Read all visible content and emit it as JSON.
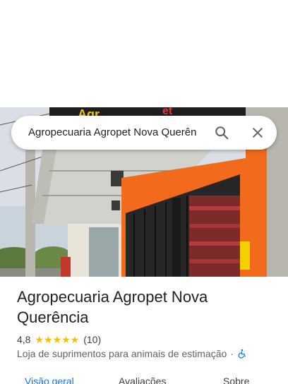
{
  "search": {
    "query": "Agropecuaria Agropet Nova Querên"
  },
  "place": {
    "name": "Agropecuaria Agropet Nova Querência",
    "rating": "4,8",
    "stars": "★★★★★",
    "review_count": "(10)",
    "category": "Loja de suprimentos para animais de estimação",
    "separator": "·",
    "accessibility_icon": "wheelchair-icon"
  },
  "tabs": [
    {
      "label": "Visão geral",
      "active": true
    },
    {
      "label": "Avaliações",
      "active": false
    },
    {
      "label": "Sobre",
      "active": false
    }
  ],
  "colors": {
    "accent": "#1a73e8",
    "star": "#fbbc04",
    "storefront_orange": "#f26a1b"
  }
}
